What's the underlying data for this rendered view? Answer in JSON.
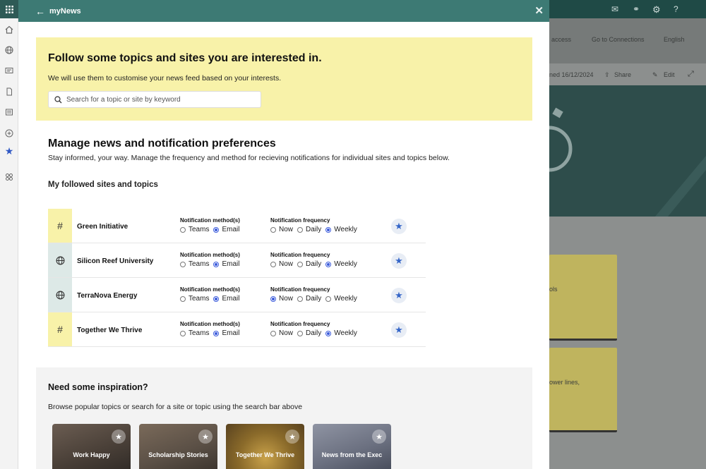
{
  "panel": {
    "title": "myNews",
    "follow": {
      "heading": "Follow some topics and sites you are interested in.",
      "subtext": "We will use them to customise your news feed based on your interests.",
      "search_placeholder": "Search for a topic or site by keyword"
    },
    "manage": {
      "heading": "Manage news and notification preferences",
      "subtext": "Stay informed, your way. Manage the frequency and method for recieving notifications for individual sites and topics below.",
      "followed_heading": "My followed sites and topics"
    },
    "method_label": "Notification method(s)",
    "frequency_label": "Notification frequency",
    "method_options": [
      "Teams",
      "Email"
    ],
    "frequency_options": [
      "Now",
      "Daily",
      "Weekly"
    ],
    "items": [
      {
        "name": "Green Initiative",
        "icon": "hashtag-icon",
        "method": "Email",
        "frequency": "Weekly",
        "color": "#f8f2a9"
      },
      {
        "name": "Silicon Reef University",
        "icon": "globe-icon",
        "method": "Email",
        "frequency": "Weekly",
        "color": "#dde9e7"
      },
      {
        "name": "TerraNova Energy",
        "icon": "globe-icon",
        "method": "Email",
        "frequency": "Now",
        "color": "#dde9e7"
      },
      {
        "name": "Together We Thrive",
        "icon": "hashtag-icon",
        "method": "Email",
        "frequency": "Weekly",
        "color": "#f8f2a9"
      }
    ],
    "inspiration": {
      "heading": "Need some inspiration?",
      "subtext": "Browse popular topics or search for a site or topic using the search bar above",
      "tiles": [
        "Work Happy",
        "Scholarship Stories",
        "Together We Thrive",
        "News from the Exec"
      ]
    }
  },
  "background": {
    "link_access": "access",
    "link_connections": "Go to Connections",
    "link_language": "English",
    "published": "ned 16/12/2024",
    "share": "Share",
    "edit": "Edit",
    "card1_text": "ols",
    "card2_text": "ower lines,"
  },
  "colors": {
    "header": "#3d7a74",
    "accent": "#3b5bdb",
    "follow_bg": "#f8f2a9"
  }
}
